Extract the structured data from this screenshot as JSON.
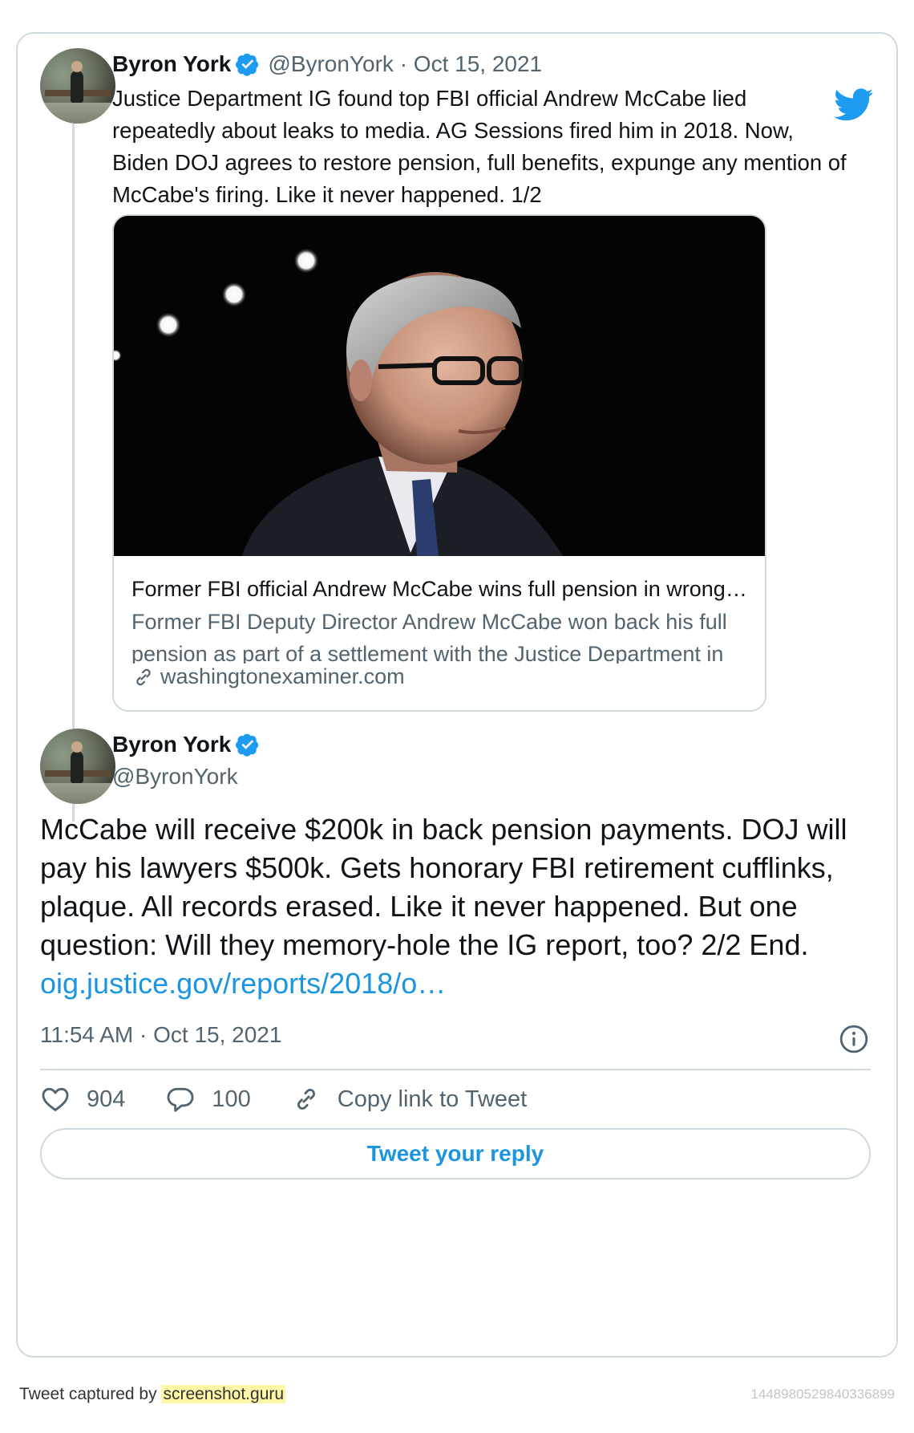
{
  "tweet1": {
    "author_name": "Byron York",
    "handle_date": "@ByronYork · Oct 15, 2021",
    "text": "Justice Department IG found top FBI official Andrew McCabe lied repeatedly about leaks to media. AG Sessions fired him in 2018. Now, Biden DOJ agrees to restore pension, full benefits, expunge any mention of McCabe's firing. Like it never happened. 1/2",
    "link_card": {
      "title": "Former FBI official Andrew McCabe wins full pension in wrongf…",
      "description": "Former FBI Deputy Director Andrew McCabe won back his full pension as part of a settlement with the Justice Department in a…",
      "domain": "washingtonexaminer.com"
    }
  },
  "tweet2": {
    "author_name": "Byron York",
    "handle": "@ByronYork",
    "text": "McCabe will receive $200k in back pension payments. DOJ will pay his lawyers $500k. Gets honorary FBI retirement cufflinks, plaque. All records erased. Like it never happened. But one question: Will they memory-hole the IG report, too? 2/2 End.",
    "link_text": "oig.justice.gov/reports/2018/o…",
    "timestamp": "11:54 AM · Oct 15, 2021",
    "likes": "904",
    "replies": "100",
    "copy_link_label": "Copy link to Tweet",
    "reply_button_label": "Tweet your reply"
  },
  "footer": {
    "captured_by": "Tweet captured by",
    "brand": "screenshot.guru",
    "tweet_id": "1448980529840336899"
  },
  "icons": {
    "verified": "verified-badge-icon",
    "bird": "twitter-bird-icon",
    "info": "info-icon",
    "like": "heart-icon",
    "reply": "reply-icon",
    "copy_link": "link-icon"
  },
  "colors": {
    "brand_blue": "#1d9bf0",
    "link_blue": "#1b95e0",
    "secondary_text": "#536471",
    "border": "#cfd9de",
    "highlight": "#fff7a8"
  }
}
